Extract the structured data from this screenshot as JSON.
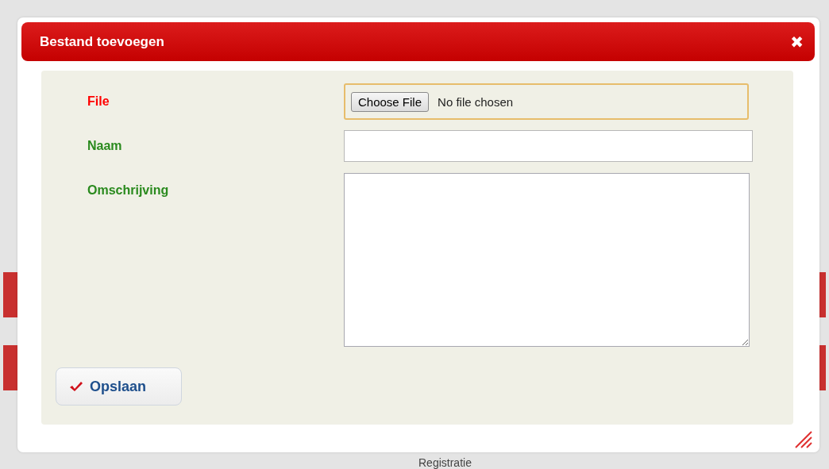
{
  "dialog": {
    "title": "Bestand toevoegen",
    "close_label": "✖",
    "fields": [
      {
        "kind": "file",
        "label": "File",
        "color": "#ff0000",
        "button_label": "Choose File",
        "status": "No file chosen",
        "focused": true
      },
      {
        "kind": "text",
        "label": "Naam",
        "color": "#2a8a1e",
        "focused": false
      },
      {
        "kind": "textarea",
        "label": "Omschrijving",
        "color": "#2a8a1e",
        "focused": false
      }
    ],
    "save_button": {
      "label": "Opslaan"
    }
  },
  "background": {
    "column_label": "Registratie"
  }
}
